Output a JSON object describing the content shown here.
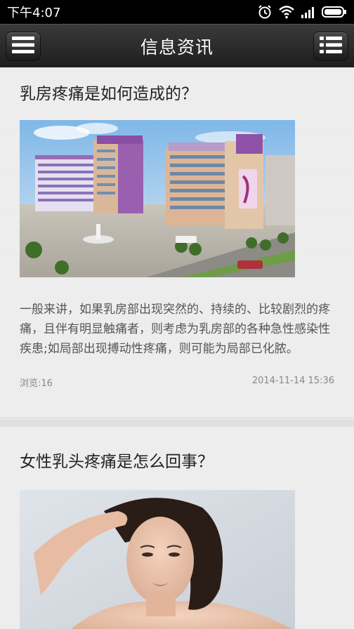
{
  "status_bar": {
    "time": "下午4:07",
    "icons": [
      "alarm-icon",
      "wifi-icon",
      "signal-icon",
      "battery-icon"
    ]
  },
  "header": {
    "title": "信息资讯",
    "left_icon": "menu-icon",
    "right_icon": "list-icon"
  },
  "articles": [
    {
      "title": "乳房疼痛是如何造成的？",
      "image": "hospital-building-image",
      "description": "一般来讲，如果乳房部出现突然的、持续的、比较剧烈的疼痛，且伴有明显触痛者，则考虑为乳房部的各种急性感染性疾患;如局部出现搏动性疼痛，则可能为局部已化脓。",
      "views": "浏览:16",
      "date": "2014-11-14 15:36"
    },
    {
      "title": "女性乳头疼痛是怎么回事？",
      "image": "woman-portrait-image"
    }
  ],
  "colors": {
    "header_bg": "#2a2a2a",
    "page_bg": "#eeeeee",
    "title_text": "#222222",
    "desc_text": "#555555",
    "meta_text": "#888888"
  }
}
